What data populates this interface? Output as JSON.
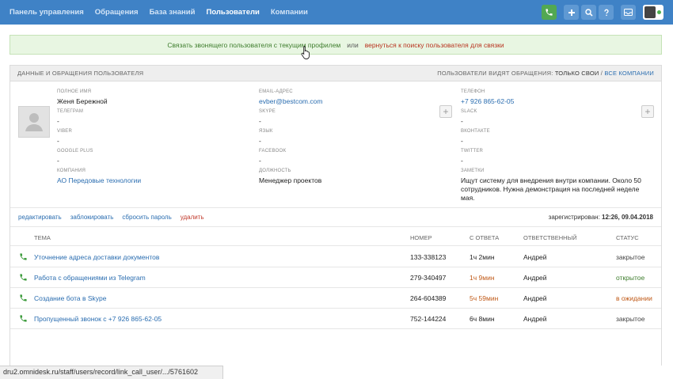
{
  "nav": {
    "items": [
      "Панель управления",
      "Обращения",
      "База знаний",
      "Пользователи",
      "Компании"
    ],
    "active": 3
  },
  "icons": [
    "phone-icon",
    "plus-icon",
    "search-icon",
    "help-icon",
    "inbox-icon"
  ],
  "alert": {
    "link_profile": "Связать звонящего пользователя с текущим профилем",
    "or": "или",
    "link_search": "вернуться к поиску пользователя для связки"
  },
  "panel": {
    "title": "Данные и обращения пользователя",
    "visibility_prefix": "Пользователи видят обращения:",
    "visibility_own": "только свои",
    "visibility_sep": "/",
    "visibility_all": "все компании"
  },
  "fields": {
    "full_name": {
      "label": "Полное имя",
      "value": "Женя Бережной"
    },
    "telegram": {
      "label": "Телеграм",
      "value": "-"
    },
    "viber": {
      "label": "Viber",
      "value": "-"
    },
    "google_plus": {
      "label": "Google Plus",
      "value": "-"
    },
    "company": {
      "label": "Компания",
      "value": "АО Передовые технологии"
    },
    "email": {
      "label": "Email-адрес",
      "value": "evber@bestcom.com"
    },
    "skype": {
      "label": "Skype",
      "value": "-"
    },
    "language": {
      "label": "Язык",
      "value": "-"
    },
    "facebook": {
      "label": "Facebook",
      "value": "-"
    },
    "position": {
      "label": "Должность",
      "value": "Менеджер проектов"
    },
    "phone": {
      "label": "Телефон",
      "value": "+7 926 865-62-05"
    },
    "slack": {
      "label": "Slack",
      "value": "-"
    },
    "vkontakte": {
      "label": "ВКонтакте",
      "value": "-"
    },
    "twitter": {
      "label": "Twitter",
      "value": "-"
    },
    "notes": {
      "label": "Заметки",
      "value": "Ищут систему для внедрения внутри компании. Около 50 сотрудников. Нужна демонстрация на последней неделе мая."
    }
  },
  "actions": {
    "edit": "редактировать",
    "block": "заблокировать",
    "reset": "сбросить пароль",
    "delete": "удалить",
    "registered_label": "зарегистрирован:",
    "registered_value": "12:26, 09.04.2018"
  },
  "table": {
    "headers": {
      "subject": "Тема",
      "number": "Номер",
      "since": "С ответа",
      "responsible": "Ответственный",
      "status": "Статус"
    },
    "rows": [
      {
        "subject": "Уточнение адреса доставки документов",
        "number": "133-338123",
        "since": "1ч 2мин",
        "responsible": "Андрей",
        "status": "закрытое",
        "since_color": "#222222",
        "status_color": "#444444"
      },
      {
        "subject": "Работа с обращениями из Telegram",
        "number": "279-340497",
        "since": "1ч 9мин",
        "responsible": "Андрей",
        "status": "открытое",
        "since_color": "#c05a18",
        "status_color": "#3e7d2d"
      },
      {
        "subject": "Создание бота в Skype",
        "number": "264-604389",
        "since": "5ч 59мин",
        "responsible": "Андрей",
        "status": "в ожидании",
        "since_color": "#c05a18",
        "status_color": "#c05a18"
      },
      {
        "subject": "Пропущенный звонок с +7 926 865-62-05",
        "number": "752-144224",
        "since": "6ч 8мин",
        "responsible": "Андрей",
        "status": "закрытое",
        "since_color": "#222222",
        "status_color": "#444444"
      }
    ]
  },
  "statusbar": "dru2.omnidesk.ru/staff/users/record/link_call_user/.../5761602"
}
